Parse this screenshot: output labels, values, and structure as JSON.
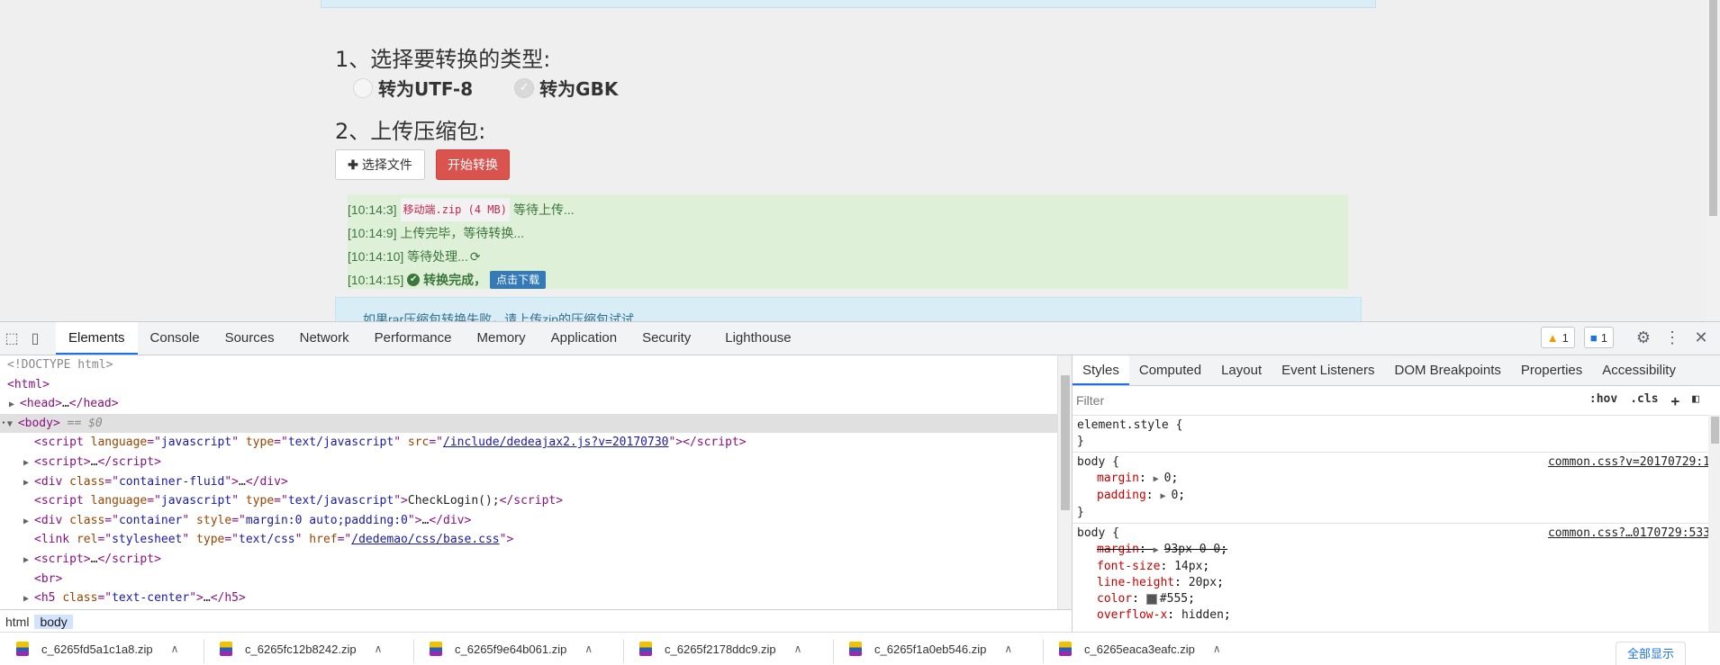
{
  "page": {
    "step1_title": "1、选择要转换的类型:",
    "options": [
      {
        "label": "转为UTF-8",
        "checked": false
      },
      {
        "label": "转为GBK",
        "checked": true
      }
    ],
    "step2_title": "2、上传压缩包:",
    "choose_file_label": "选择文件",
    "choose_file_icon": "plus-icon",
    "start_label": "开始转换",
    "log": [
      {
        "time": "[10:14:3]",
        "file": "移动端.zip (4 MB)",
        "text": "等待上传..."
      },
      {
        "time": "[10:14:9]",
        "text": "上传完毕，等待转换..."
      },
      {
        "time": "[10:14:10]",
        "text": "等待处理..."
      },
      {
        "time": "[10:14:15]",
        "text": "转换完成，",
        "download": "点击下载"
      }
    ],
    "info_text": "如果rar压缩包转换失败，请上传zip的压缩包试试"
  },
  "devtools": {
    "tabs": [
      "Elements",
      "Console",
      "Sources",
      "Network",
      "Performance",
      "Memory",
      "Application",
      "Security",
      "Lighthouse"
    ],
    "active_tab": "Elements",
    "warning_count": "1",
    "message_count": "1",
    "dom": {
      "l0": "<!DOCTYPE html>",
      "l1_tag": "<html>",
      "l2_tag": "<head>",
      "l2_close": "</head>",
      "l3_tag": "<body>",
      "l3_marker": "== $0",
      "l4": {
        "script_lang": "javascript",
        "script_type": "text/javascript",
        "src": "/include/dedeajax2.js?v=20170730"
      },
      "l6": {
        "class": "container-fluid"
      },
      "l7": {
        "lang": "javascript",
        "type": "text/javascript",
        "text": "CheckLogin();"
      },
      "l8": {
        "class": "container",
        "style": "margin:0 auto;padding:0"
      },
      "l9": {
        "rel": "stylesheet",
        "type": "text/css",
        "href": "/dedemao/css/base.css"
      },
      "l12": {
        "class": "text-center"
      }
    },
    "breadcrumb": [
      "html",
      "body"
    ],
    "styles_tabs": [
      "Styles",
      "Computed",
      "Layout",
      "Event Listeners",
      "DOM Breakpoints",
      "Properties",
      "Accessibility"
    ],
    "filter_placeholder": "Filter",
    "filter_tools": [
      ":hov",
      ".cls",
      "+"
    ],
    "rules": {
      "r0_selector": "element.style {",
      "r1_selector": "body {",
      "r1_source": "common.css?v=20170729:1",
      "r1_margin": "0",
      "r1_padding": "0",
      "r2_selector": "body {",
      "r2_source": "common.css?…0170729:533",
      "r2_margin": "93px 0 0",
      "r2_font_size": "14px",
      "r2_line_height": "20px",
      "r2_color": "#555",
      "r2_overflow": "hidden"
    }
  },
  "downloads": {
    "items": [
      "c_6265fd5a1c1a8.zip",
      "c_6265fc12b8242.zip",
      "c_6265f9e64b061.zip",
      "c_6265f2178ddc9.zip",
      "c_6265f1a0eb546.zip",
      "c_6265eaca3eafc.zip"
    ],
    "show_all": "全部显示"
  },
  "colors": {
    "accent": "#1a73e8",
    "danger_button": "#d9534f",
    "log_bg": "#dff0d8",
    "info_bg": "#d9edf7"
  }
}
